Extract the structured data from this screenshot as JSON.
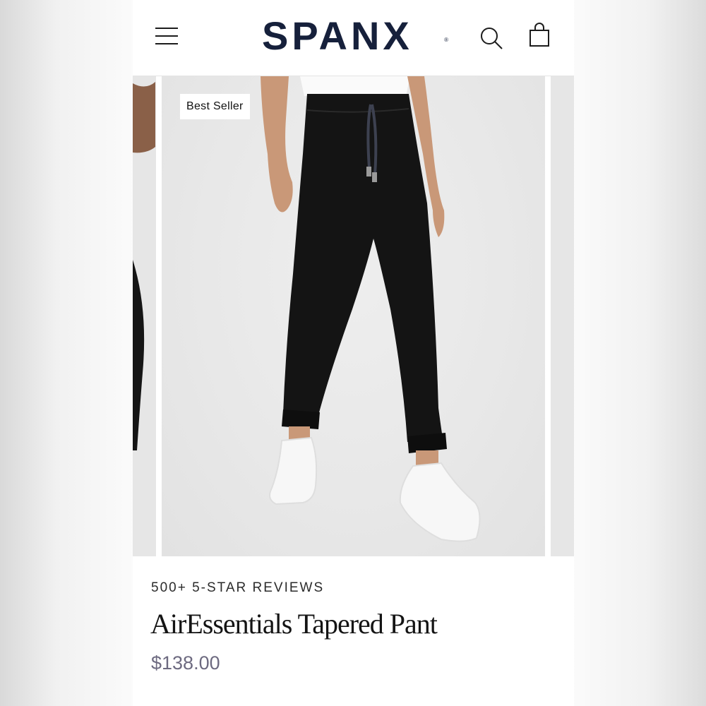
{
  "header": {
    "logo_text": "SPANX",
    "logo_mark": "®",
    "menu_icon": "hamburger-menu-icon",
    "search_icon": "search-icon",
    "cart_icon": "shopping-bag-icon"
  },
  "carousel": {
    "badge": "Best Seller"
  },
  "product": {
    "reviews": "500+ 5-STAR REVIEWS",
    "name": "AirEssentials Tapered Pant",
    "price": "$138.00"
  },
  "colors": {
    "logo": "#16203b",
    "price": "#6d6a80",
    "image_background": "#e8e8e8"
  }
}
